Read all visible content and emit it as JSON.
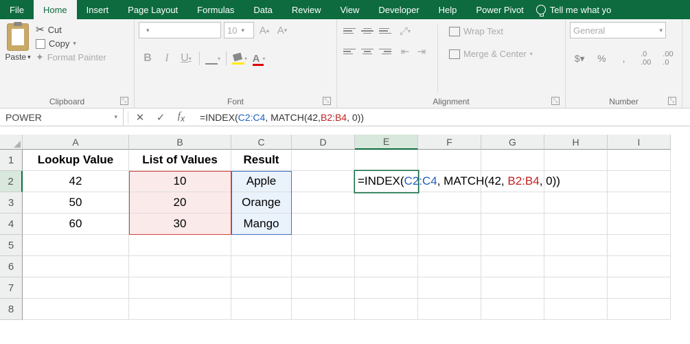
{
  "tabs": [
    "File",
    "Home",
    "Insert",
    "Page Layout",
    "Formulas",
    "Data",
    "Review",
    "View",
    "Developer",
    "Help",
    "Power Pivot"
  ],
  "activeTab": "Home",
  "tellMe": "Tell me what yo",
  "clipboard": {
    "paste": "Paste",
    "cut": "Cut",
    "copy": "Copy",
    "formatPainter": "Format Painter",
    "groupLabel": "Clipboard"
  },
  "font": {
    "name": "",
    "size": "10",
    "groupLabel": "Font"
  },
  "alignment": {
    "wrap": "Wrap Text",
    "merge": "Merge & Center",
    "groupLabel": "Alignment"
  },
  "number": {
    "format": "General",
    "groupLabel": "Number"
  },
  "nameBox": "POWER",
  "formulaBar": {
    "prefix": "=INDEX(",
    "ref1": "C2:C4",
    "mid1": ", MATCH(42, ",
    "ref2": "B2:B4",
    "mid2": ", 0",
    "suffix": "))"
  },
  "columns": [
    "A",
    "B",
    "C",
    "D",
    "E",
    "F",
    "G",
    "H",
    "I"
  ],
  "rows": [
    "1",
    "2",
    "3",
    "4",
    "5",
    "6",
    "7",
    "8"
  ],
  "data": {
    "A1": "Lookup Value",
    "B1": "List of Values",
    "C1": "Result",
    "A2": "42",
    "B2": "10",
    "C2": "Apple",
    "A3": "50",
    "B3": "20",
    "C3": "Orange",
    "A4": "60",
    "B4": "30",
    "C4": "Mango"
  },
  "editingCell": {
    "prefix": "=INDEX(",
    "r1": "C2:C4",
    "m1": ", MATCH(42, ",
    "r2": "B2:B4",
    "m2": ", 0",
    "suffix": "))"
  }
}
